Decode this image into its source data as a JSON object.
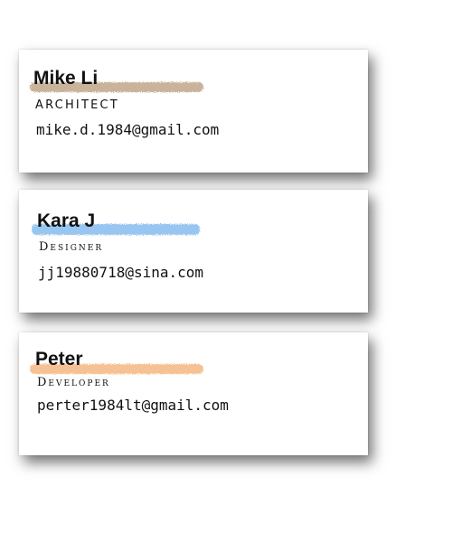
{
  "cards": [
    {
      "name": "Mike Li",
      "title": "ARCHITECT",
      "email": "mike.d.1984@gmail.com",
      "highlight_color": "#b99a7a"
    },
    {
      "name": "Kara J",
      "title": "Designer",
      "email": "jj19880718@sina.com",
      "highlight_color": "#7fb8ee"
    },
    {
      "name": "Peter",
      "title": "Developer",
      "email": "perter1984lt@gmail.com",
      "highlight_color": "#f5b27a"
    }
  ]
}
